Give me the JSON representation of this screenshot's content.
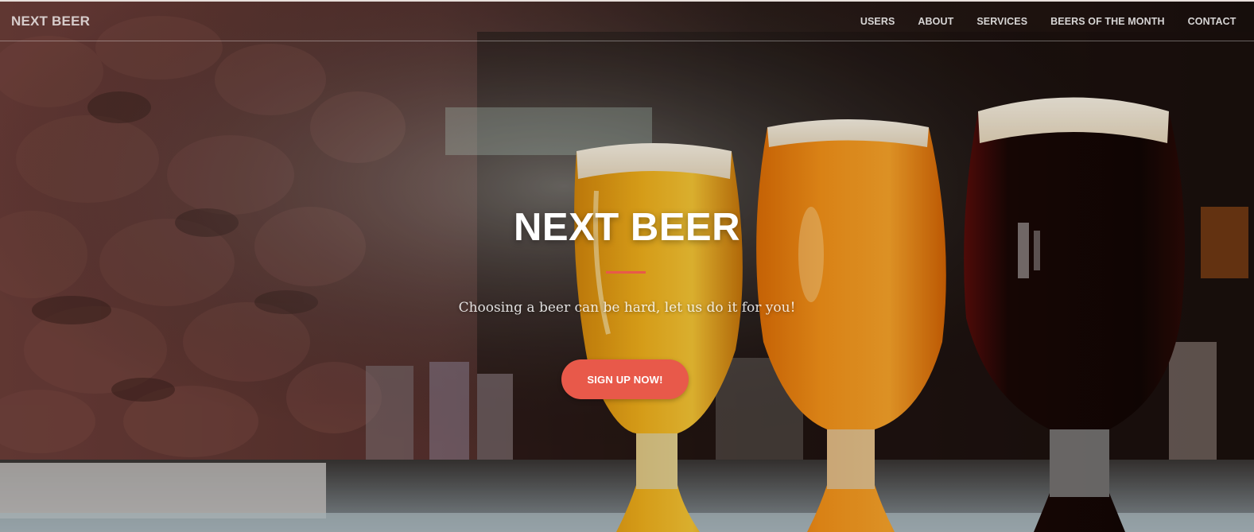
{
  "navbar": {
    "brand": "NEXT BEER",
    "links": [
      "USERS",
      "ABOUT",
      "SERVICES",
      "BEERS OF THE MONTH",
      "CONTACT"
    ]
  },
  "hero": {
    "title": "NEXT BEER",
    "subtitle": "Choosing a beer can be hard, let us do it for you!",
    "cta_label": "SIGN UP NOW!"
  },
  "colors": {
    "accent": "#e8594a",
    "text": "#ffffff"
  },
  "background_image": {
    "description_icon": "beer-glasses-photo"
  }
}
